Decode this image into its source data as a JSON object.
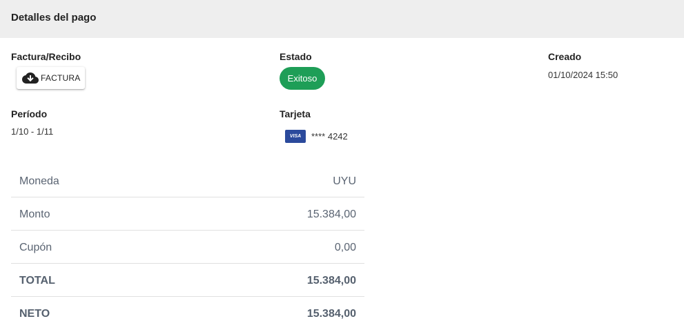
{
  "header": {
    "title": "Detalles del pago"
  },
  "invoice": {
    "label": "Factura/Recibo",
    "button_label": "FACTURA",
    "icon": "cloud-download-icon"
  },
  "status": {
    "label": "Estado",
    "value": "Exitoso",
    "color": "#1e9e57"
  },
  "created": {
    "label": "Creado",
    "value": "01/10/2024 15:50"
  },
  "period": {
    "label": "Período",
    "value": "1/10 - 1/11"
  },
  "card": {
    "label": "Tarjeta",
    "brand": "VISA",
    "number": "**** 4242",
    "brand_color": "#2b4a9c"
  },
  "summary": {
    "rows": [
      {
        "label": "Moneda",
        "value": "UYU"
      },
      {
        "label": "Monto",
        "value": "15.384,00"
      },
      {
        "label": "Cupón",
        "value": "0,00"
      },
      {
        "label": "TOTAL",
        "value": "15.384,00"
      },
      {
        "label": "NETO",
        "value": "15.384,00"
      }
    ]
  }
}
